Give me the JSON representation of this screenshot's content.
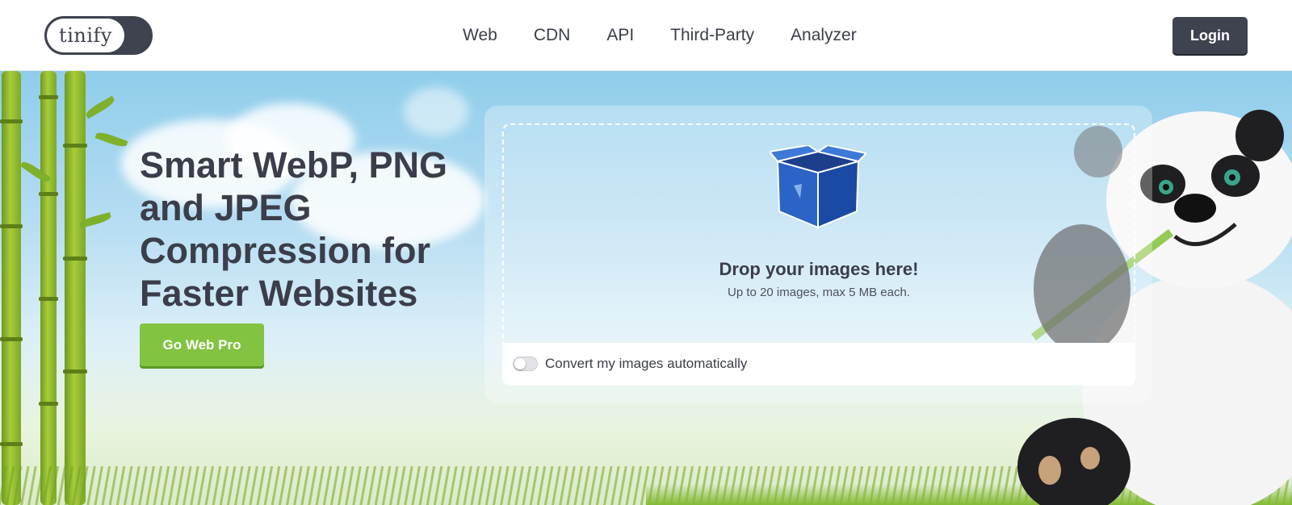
{
  "brand": {
    "logo_text": "tinify"
  },
  "nav": {
    "items": [
      "Web",
      "CDN",
      "API",
      "Third-Party",
      "Analyzer"
    ],
    "login_label": "Login"
  },
  "hero": {
    "headline_lines": [
      "Smart WebP, PNG",
      "and JPEG",
      "Compression for",
      "Faster Websites"
    ],
    "cta_label": "Go Web Pro"
  },
  "dropzone": {
    "title": "Drop your images here!",
    "subtitle": "Up to 20 images, max 5 MB each.",
    "convert_label": "Convert my images automatically",
    "convert_enabled": false
  },
  "icons": [
    "box-icon",
    "panda-mascot",
    "toggle-switch"
  ],
  "colors": {
    "dark": "#3f434f",
    "cta_green": "#82c341",
    "sky_top": "#8fcdeb",
    "sky_bottom": "#dceff8"
  }
}
